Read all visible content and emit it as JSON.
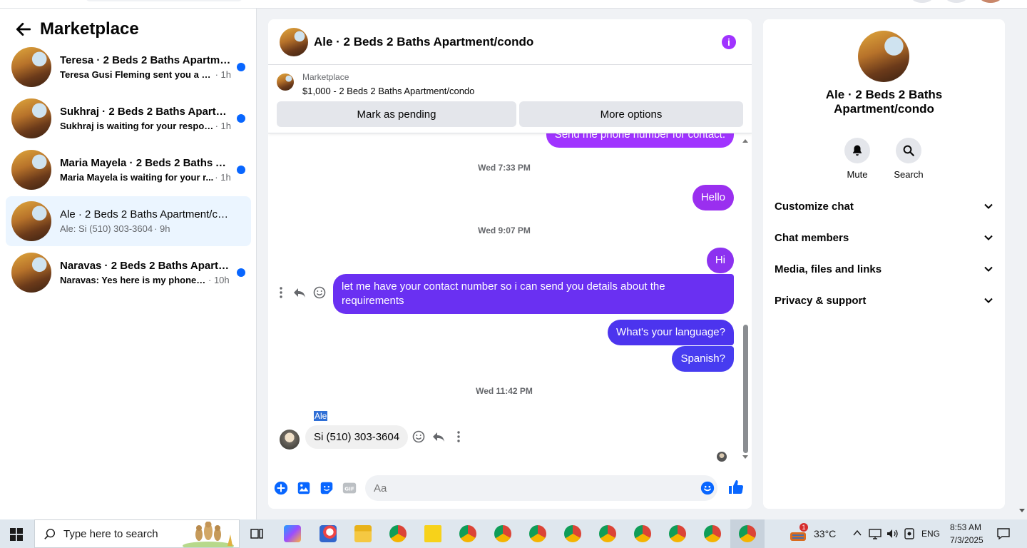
{
  "sidebar": {
    "title": "Marketplace",
    "conversations": [
      {
        "name": "Teresa · 2 Beds 2 Baths Apartme...",
        "snippet": "Teresa Gusi Fleming sent you a me...",
        "time": "· 1h",
        "unread": true
      },
      {
        "name": "Sukhraj · 2 Beds 2 Baths Apartm...",
        "snippet": "Sukhraj is waiting for your response.",
        "time": "· 1h",
        "unread": true
      },
      {
        "name": "Maria Mayela · 2 Beds 2 Baths A...",
        "snippet": "Maria Mayela is waiting for your r...",
        "time": "· 1h",
        "unread": true
      },
      {
        "name": "Ale · 2 Beds 2 Baths Apartment/co...",
        "snippet": "Ale: Si (510) 303-3604",
        "time": "· 9h",
        "unread": false,
        "active": true
      },
      {
        "name": "Naravas · 2 Beds 2 Baths Apartm...",
        "snippet": "Naravas: Yes here is my phone nu...",
        "time": "· 10h",
        "unread": true
      }
    ]
  },
  "chat": {
    "title": "Ale · 2 Beds 2 Baths Apartment/condo",
    "marketplace_label": "Marketplace",
    "listing": "$1,000 - 2 Beds 2 Baths Apartment/condo",
    "btn_pending": "Mark as pending",
    "btn_more": "More options",
    "partial_message": "Send me phone number for contact.",
    "ts1": "Wed 7:33 PM",
    "msg_hello": "Hello",
    "ts2": "Wed 9:07 PM",
    "msg_hi": "Hi",
    "msg_contact": "let me have your contact number so i can send you details about the requirements",
    "msg_language": "What's your language?",
    "msg_spanish": "Spanish?",
    "ts3": "Wed 11:42 PM",
    "sender": "Ale",
    "msg_reply": "Si (510) 303-3604",
    "input_placeholder": "Aa",
    "accent": "#a033ff"
  },
  "details": {
    "name": "Ale · 2 Beds 2 Baths Apartment/condo",
    "mute": "Mute",
    "search": "Search",
    "sections": [
      "Customize chat",
      "Chat members",
      "Media, files and links",
      "Privacy & support"
    ]
  },
  "taskbar": {
    "search_placeholder": "Type here to search",
    "temperature": "33°C",
    "lang": "ENG",
    "time": "8:53 AM",
    "date": "7/3/2025",
    "weather_badge": "1"
  }
}
